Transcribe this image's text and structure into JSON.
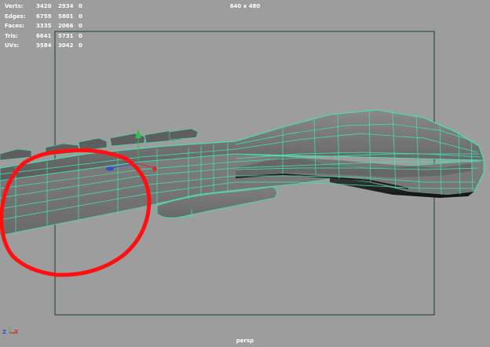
{
  "stats": {
    "rows": [
      {
        "label": "Verts:",
        "values": [
          "3420",
          "2934",
          "0"
        ]
      },
      {
        "label": "Edges:",
        "values": [
          "6759",
          "5801",
          "0"
        ]
      },
      {
        "label": "Faces:",
        "values": [
          "3335",
          "2066",
          "0"
        ]
      },
      {
        "label": "Tris:",
        "values": [
          "6641",
          "5731",
          "0"
        ]
      },
      {
        "label": "UVs:",
        "values": [
          "3584",
          "3042",
          "0"
        ]
      }
    ]
  },
  "viewport": {
    "resolution_label": "640 x 480",
    "camera_name": "persp"
  },
  "axis_indicator": {
    "z": "Z",
    "x": "X"
  },
  "colors": {
    "background": "#9d9d9d",
    "wireframe": "#3fe6b4",
    "annotation": "#ff1010",
    "gate": "#1f3a2f"
  }
}
